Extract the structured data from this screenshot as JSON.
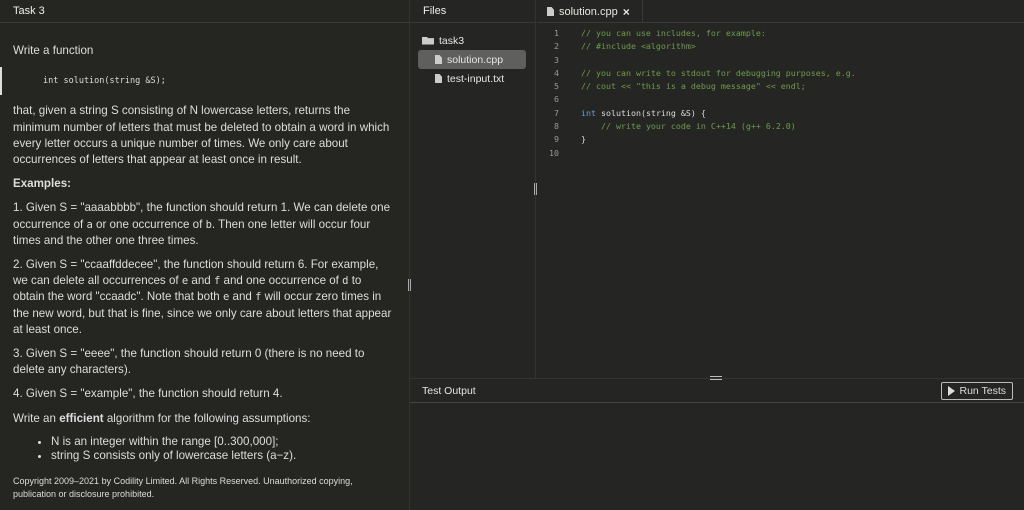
{
  "task": {
    "title": "Task 3",
    "intro": "Write a function",
    "signature": "int solution(string &S);",
    "para": "that, given a string S consisting of N lowercase letters, returns the minimum number of letters that must be deleted to obtain a word in which every letter occurs a unique number of times. We only care about occurrences of letters that appear at least once in result.",
    "examples_heading": "Examples:",
    "ex1": [
      "1. Given S = \"aaaabbbb\", the function should return 1. We can delete one occurrence of ",
      "a",
      " or one occurrence of ",
      "b",
      ". Then one letter will occur four times and the other one three times."
    ],
    "ex2": [
      "2. Given S = \"ccaaffddecee\", the function should return 6. For example, we can delete all occurrences of ",
      "e",
      " and ",
      "f",
      " and one occurrence of ",
      "d",
      " to obtain the word \"ccaadc\". Note that both ",
      "e",
      " and ",
      "f",
      " will occur zero times in the new word, but that is fine, since we only care about letters that appear at least once."
    ],
    "ex3": "3. Given S = \"eeee\", the function should return 0 (there is no need to delete any characters).",
    "ex4": "4. Given S = \"example\", the function should return 4.",
    "efficient": [
      "Write an ",
      "efficient",
      " algorithm for the following assumptions:"
    ],
    "assumptions": [
      "N is an integer within the range [0..300,000];",
      "string S consists only of lowercase letters (a−z)."
    ],
    "copyright": "Copyright 2009–2021 by Codility Limited. All Rights Reserved. Unauthorized copying, publication or disclosure prohibited."
  },
  "files": {
    "title": "Files",
    "folder": "task3",
    "items": [
      "solution.cpp",
      "test-input.txt"
    ]
  },
  "editor": {
    "tab": "solution.cpp",
    "close": "×",
    "lines": [
      [
        [
          "cm",
          "// you can use includes, for example:"
        ]
      ],
      [
        [
          "cm",
          "// #include <algorithm>"
        ]
      ],
      [],
      [
        [
          "cm",
          "// you can write to stdout for debugging purposes, e.g."
        ]
      ],
      [
        [
          "cm",
          "// cout << \"this is a debug message\" << endl;"
        ]
      ],
      [],
      [
        [
          "kw",
          "int"
        ],
        [
          "tx",
          " solution(string &S) {"
        ]
      ],
      [
        [
          "tx",
          "    "
        ],
        [
          "cm",
          "// write your code in C++14 (g++ 6.2.0)"
        ]
      ],
      [
        [
          "tx",
          "}"
        ]
      ],
      []
    ]
  },
  "output": {
    "title": "Test Output",
    "run_label": "Run Tests"
  }
}
